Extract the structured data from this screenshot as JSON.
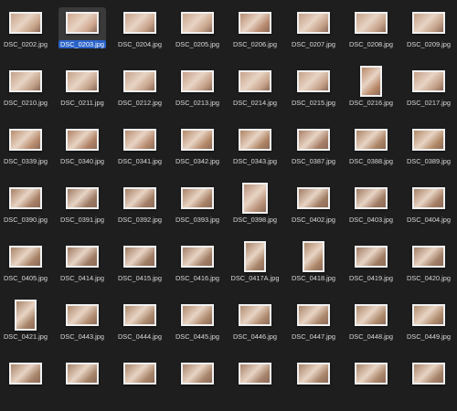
{
  "files": [
    {
      "name": "DSC_0202.jpg",
      "shape": "landscape",
      "tone": "#c8a48a"
    },
    {
      "name": "DSC_0203.jpg",
      "shape": "landscape",
      "tone": "#d0a890",
      "selected": true
    },
    {
      "name": "DSC_0204.jpg",
      "shape": "landscape",
      "tone": "#c8a28a"
    },
    {
      "name": "DSC_0205.jpg",
      "shape": "landscape",
      "tone": "#c9a58c"
    },
    {
      "name": "DSC_0206.jpg",
      "shape": "landscape",
      "tone": "#b88a70"
    },
    {
      "name": "DSC_0207.jpg",
      "shape": "landscape",
      "tone": "#c4a088"
    },
    {
      "name": "DSC_0208.jpg",
      "shape": "landscape",
      "tone": "#c7a38a"
    },
    {
      "name": "DSC_0209.jpg",
      "shape": "landscape",
      "tone": "#c3a088"
    },
    {
      "name": "DSC_0210.jpg",
      "shape": "landscape",
      "tone": "#c2a088"
    },
    {
      "name": "DSC_0211.jpg",
      "shape": "landscape",
      "tone": "#c4a28a"
    },
    {
      "name": "DSC_0212.jpg",
      "shape": "landscape",
      "tone": "#c6a38b"
    },
    {
      "name": "DSC_0213.jpg",
      "shape": "landscape",
      "tone": "#c5a089"
    },
    {
      "name": "DSC_0214.jpg",
      "shape": "landscape",
      "tone": "#c8a48c"
    },
    {
      "name": "DSC_0215.jpg",
      "shape": "landscape",
      "tone": "#c6a28a"
    },
    {
      "name": "DSC_0216.jpg",
      "shape": "portrait",
      "tone": "#b88868"
    },
    {
      "name": "DSC_0217.jpg",
      "shape": "landscape",
      "tone": "#c4a088"
    },
    {
      "name": "DSC_0339.jpg",
      "shape": "landscape",
      "tone": "#b88c6e"
    },
    {
      "name": "DSC_0340.jpg",
      "shape": "landscape",
      "tone": "#b08266"
    },
    {
      "name": "DSC_0341.jpg",
      "shape": "landscape",
      "tone": "#b88c70"
    },
    {
      "name": "DSC_0342.jpg",
      "shape": "landscape",
      "tone": "#b48868"
    },
    {
      "name": "DSC_0343.jpg",
      "shape": "landscape",
      "tone": "#ae8464"
    },
    {
      "name": "DSC_0387.jpg",
      "shape": "landscape",
      "tone": "#a88068"
    },
    {
      "name": "DSC_0388.jpg",
      "shape": "landscape",
      "tone": "#ac8466"
    },
    {
      "name": "DSC_0389.jpg",
      "shape": "landscape",
      "tone": "#b08866"
    },
    {
      "name": "DSC_0390.jpg",
      "shape": "landscape",
      "tone": "#a88066"
    },
    {
      "name": "DSC_0391.jpg",
      "shape": "landscape",
      "tone": "#9c7a64"
    },
    {
      "name": "DSC_0392.jpg",
      "shape": "landscape",
      "tone": "#a47e66"
    },
    {
      "name": "DSC_0393.jpg",
      "shape": "landscape",
      "tone": "#a88266"
    },
    {
      "name": "DSC_0398.jpg",
      "shape": "large",
      "tone": "#b89078"
    },
    {
      "name": "DSC_0402.jpg",
      "shape": "landscape",
      "tone": "#a07c64"
    },
    {
      "name": "DSC_0403.jpg",
      "shape": "landscape",
      "tone": "#9e7a62"
    },
    {
      "name": "DSC_0404.jpg",
      "shape": "landscape",
      "tone": "#a47e64"
    },
    {
      "name": "DSC_0405.jpg",
      "shape": "landscape",
      "tone": "#a88266"
    },
    {
      "name": "DSC_0414.jpg",
      "shape": "landscape",
      "tone": "#9e7a64"
    },
    {
      "name": "DSC_0415.jpg",
      "shape": "landscape",
      "tone": "#a07c64"
    },
    {
      "name": "DSC_0416.jpg",
      "shape": "landscape",
      "tone": "#a27e66"
    },
    {
      "name": "DSC_0417A.jpg",
      "shape": "portrait",
      "tone": "#a88468"
    },
    {
      "name": "DSC_0418.jpg",
      "shape": "portrait",
      "tone": "#ac8668"
    },
    {
      "name": "DSC_0419.jpg",
      "shape": "landscape",
      "tone": "#a07c64"
    },
    {
      "name": "DSC_0420.jpg",
      "shape": "landscape",
      "tone": "#a27e66"
    },
    {
      "name": "DSC_0421.jpg",
      "shape": "portrait",
      "tone": "#a88468"
    },
    {
      "name": "DSC_0443.jpg",
      "shape": "landscape",
      "tone": "#b08c70"
    },
    {
      "name": "DSC_0444.jpg",
      "shape": "landscape",
      "tone": "#ac8a6e"
    },
    {
      "name": "DSC_0445.jpg",
      "shape": "landscape",
      "tone": "#ae8a6e"
    },
    {
      "name": "DSC_0446.jpg",
      "shape": "landscape",
      "tone": "#b08c70"
    },
    {
      "name": "DSC_0447.jpg",
      "shape": "landscape",
      "tone": "#aa866a"
    },
    {
      "name": "DSC_0448.jpg",
      "shape": "landscape",
      "tone": "#ae8a6c"
    },
    {
      "name": "DSC_0449.jpg",
      "shape": "landscape",
      "tone": "#b08c6e"
    },
    {
      "name": "",
      "shape": "landscape",
      "tone": "#a8846a"
    },
    {
      "name": "",
      "shape": "landscape",
      "tone": "#a6846a"
    },
    {
      "name": "",
      "shape": "landscape",
      "tone": "#aa866a"
    },
    {
      "name": "",
      "shape": "landscape",
      "tone": "#a8846a"
    },
    {
      "name": "",
      "shape": "landscape",
      "tone": "#a6826a"
    },
    {
      "name": "",
      "shape": "landscape",
      "tone": "#a8846a"
    },
    {
      "name": "",
      "shape": "landscape",
      "tone": "#aa866a"
    },
    {
      "name": "",
      "shape": "landscape",
      "tone": "#a8846a"
    }
  ]
}
